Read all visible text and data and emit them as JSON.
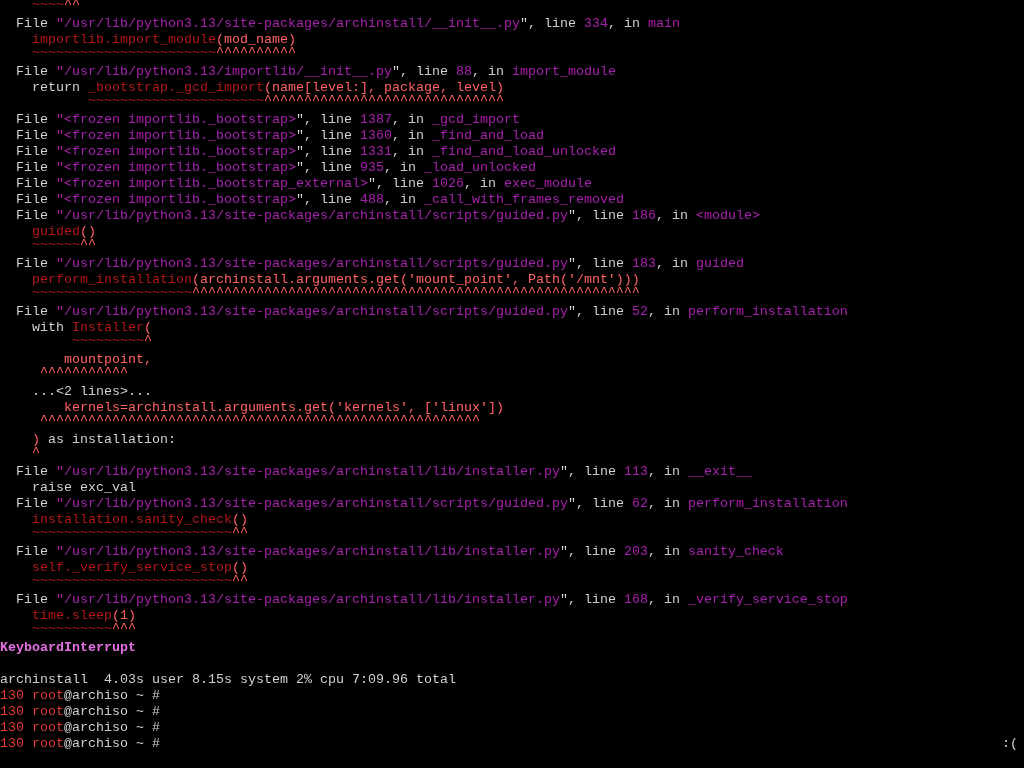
{
  "terminal": {
    "lines": [
      {
        "kind": "marks",
        "segments": [
          {
            "kind": "code",
            "text": "    ~~~~"
          },
          {
            "kind": "mark",
            "text": "^^"
          }
        ]
      },
      {
        "kind": "text",
        "segments": [
          {
            "kind": "plain",
            "text": "  File "
          },
          {
            "kind": "path",
            "text": "\"/usr/lib/python3.13/site-packages/archinstall/__init__.py"
          },
          {
            "kind": "plain",
            "text": "\", line "
          },
          {
            "kind": "path",
            "text": "334"
          },
          {
            "kind": "plain",
            "text": ", in "
          },
          {
            "kind": "path",
            "text": "main"
          }
        ]
      },
      {
        "kind": "text",
        "segments": [
          {
            "kind": "code",
            "text": "    importlib.import_module"
          },
          {
            "kind": "mark",
            "text": "(mod_name)"
          }
        ]
      },
      {
        "kind": "marks",
        "segments": [
          {
            "kind": "code",
            "text": "    ~~~~~~~~~~~~~~~~~~~~~~~"
          },
          {
            "kind": "mark",
            "text": "^^^^^^^^^^"
          }
        ]
      },
      {
        "kind": "text",
        "segments": [
          {
            "kind": "plain",
            "text": "  File "
          },
          {
            "kind": "path",
            "text": "\"/usr/lib/python3.13/importlib/__init__.py"
          },
          {
            "kind": "plain",
            "text": "\", line "
          },
          {
            "kind": "path",
            "text": "88"
          },
          {
            "kind": "plain",
            "text": ", in "
          },
          {
            "kind": "path",
            "text": "import_module"
          }
        ]
      },
      {
        "kind": "text",
        "segments": [
          {
            "kind": "plain",
            "text": "    return "
          },
          {
            "kind": "code",
            "text": "_bootstrap._gcd_import"
          },
          {
            "kind": "mark",
            "text": "(name[level:], package, level)"
          }
        ]
      },
      {
        "kind": "marks",
        "segments": [
          {
            "kind": "code",
            "text": "           ~~~~~~~~~~~~~~~~~~~~~~"
          },
          {
            "kind": "mark",
            "text": "^^^^^^^^^^^^^^^^^^^^^^^^^^^^^^"
          }
        ]
      },
      {
        "kind": "text",
        "segments": [
          {
            "kind": "plain",
            "text": "  File "
          },
          {
            "kind": "path",
            "text": "\"<frozen importlib._bootstrap>"
          },
          {
            "kind": "plain",
            "text": "\", line "
          },
          {
            "kind": "path",
            "text": "1387"
          },
          {
            "kind": "plain",
            "text": ", in "
          },
          {
            "kind": "path",
            "text": "_gcd_import"
          }
        ]
      },
      {
        "kind": "text",
        "segments": [
          {
            "kind": "plain",
            "text": "  File "
          },
          {
            "kind": "path",
            "text": "\"<frozen importlib._bootstrap>"
          },
          {
            "kind": "plain",
            "text": "\", line "
          },
          {
            "kind": "path",
            "text": "1360"
          },
          {
            "kind": "plain",
            "text": ", in "
          },
          {
            "kind": "path",
            "text": "_find_and_load"
          }
        ]
      },
      {
        "kind": "text",
        "segments": [
          {
            "kind": "plain",
            "text": "  File "
          },
          {
            "kind": "path",
            "text": "\"<frozen importlib._bootstrap>"
          },
          {
            "kind": "plain",
            "text": "\", line "
          },
          {
            "kind": "path",
            "text": "1331"
          },
          {
            "kind": "plain",
            "text": ", in "
          },
          {
            "kind": "path",
            "text": "_find_and_load_unlocked"
          }
        ]
      },
      {
        "kind": "text",
        "segments": [
          {
            "kind": "plain",
            "text": "  File "
          },
          {
            "kind": "path",
            "text": "\"<frozen importlib._bootstrap>"
          },
          {
            "kind": "plain",
            "text": "\", line "
          },
          {
            "kind": "path",
            "text": "935"
          },
          {
            "kind": "plain",
            "text": ", in "
          },
          {
            "kind": "path",
            "text": "_load_unlocked"
          }
        ]
      },
      {
        "kind": "text",
        "segments": [
          {
            "kind": "plain",
            "text": "  File "
          },
          {
            "kind": "path",
            "text": "\"<frozen importlib._bootstrap_external>"
          },
          {
            "kind": "plain",
            "text": "\", line "
          },
          {
            "kind": "path",
            "text": "1026"
          },
          {
            "kind": "plain",
            "text": ", in "
          },
          {
            "kind": "path",
            "text": "exec_module"
          }
        ]
      },
      {
        "kind": "text",
        "segments": [
          {
            "kind": "plain",
            "text": "  File "
          },
          {
            "kind": "path",
            "text": "\"<frozen importlib._bootstrap>"
          },
          {
            "kind": "plain",
            "text": "\", line "
          },
          {
            "kind": "path",
            "text": "488"
          },
          {
            "kind": "plain",
            "text": ", in "
          },
          {
            "kind": "path",
            "text": "_call_with_frames_removed"
          }
        ]
      },
      {
        "kind": "text",
        "segments": [
          {
            "kind": "plain",
            "text": "  File "
          },
          {
            "kind": "path",
            "text": "\"/usr/lib/python3.13/site-packages/archinstall/scripts/guided.py"
          },
          {
            "kind": "plain",
            "text": "\", line "
          },
          {
            "kind": "path",
            "text": "186"
          },
          {
            "kind": "plain",
            "text": ", in "
          },
          {
            "kind": "path",
            "text": "<module>"
          }
        ]
      },
      {
        "kind": "text",
        "segments": [
          {
            "kind": "code",
            "text": "    guided"
          },
          {
            "kind": "mark",
            "text": "()"
          }
        ]
      },
      {
        "kind": "marks",
        "segments": [
          {
            "kind": "code",
            "text": "    ~~~~~~"
          },
          {
            "kind": "mark",
            "text": "^^"
          }
        ]
      },
      {
        "kind": "text",
        "segments": [
          {
            "kind": "plain",
            "text": "  File "
          },
          {
            "kind": "path",
            "text": "\"/usr/lib/python3.13/site-packages/archinstall/scripts/guided.py"
          },
          {
            "kind": "plain",
            "text": "\", line "
          },
          {
            "kind": "path",
            "text": "183"
          },
          {
            "kind": "plain",
            "text": ", in "
          },
          {
            "kind": "path",
            "text": "guided"
          }
        ]
      },
      {
        "kind": "text",
        "segments": [
          {
            "kind": "code",
            "text": "    perform_installation"
          },
          {
            "kind": "mark",
            "text": "(archinstall.arguments.get('mount_point', Path('/mnt')))"
          }
        ]
      },
      {
        "kind": "marks",
        "segments": [
          {
            "kind": "code",
            "text": "    ~~~~~~~~~~~~~~~~~~~~"
          },
          {
            "kind": "mark",
            "text": "^^^^^^^^^^^^^^^^^^^^^^^^^^^^^^^^^^^^^^^^^^^^^^^^^^^^^^^^"
          }
        ]
      },
      {
        "kind": "text",
        "segments": [
          {
            "kind": "plain",
            "text": "  File "
          },
          {
            "kind": "path",
            "text": "\"/usr/lib/python3.13/site-packages/archinstall/scripts/guided.py"
          },
          {
            "kind": "plain",
            "text": "\", line "
          },
          {
            "kind": "path",
            "text": "52"
          },
          {
            "kind": "plain",
            "text": ", in "
          },
          {
            "kind": "path",
            "text": "perform_installation"
          }
        ]
      },
      {
        "kind": "text",
        "segments": [
          {
            "kind": "plain",
            "text": "    with "
          },
          {
            "kind": "code",
            "text": "Installer"
          },
          {
            "kind": "mark",
            "text": "("
          }
        ]
      },
      {
        "kind": "marks",
        "segments": [
          {
            "kind": "code",
            "text": "         ~~~~~~~~~"
          },
          {
            "kind": "mark",
            "text": "^"
          }
        ]
      },
      {
        "kind": "text",
        "segments": [
          {
            "kind": "mark",
            "text": "        mountpoint,"
          }
        ]
      },
      {
        "kind": "marks",
        "segments": [
          {
            "kind": "mark",
            "text": "     ^^^^^^^^^^^"
          }
        ]
      },
      {
        "kind": "text",
        "segments": [
          {
            "kind": "plain",
            "text": "    ...<2 lines>..."
          }
        ]
      },
      {
        "kind": "text",
        "segments": [
          {
            "kind": "mark",
            "text": "        kernels=archinstall.arguments.get('kernels', ['linux'])"
          }
        ]
      },
      {
        "kind": "marks",
        "segments": [
          {
            "kind": "mark",
            "text": "     ^^^^^^^^^^^^^^^^^^^^^^^^^^^^^^^^^^^^^^^^^^^^^^^^^^^^^^^"
          }
        ]
      },
      {
        "kind": "text",
        "segments": [
          {
            "kind": "mark",
            "text": "    )"
          },
          {
            "kind": "plain",
            "text": " as installation:"
          }
        ]
      },
      {
        "kind": "marks",
        "segments": [
          {
            "kind": "mark",
            "text": "    ^"
          }
        ]
      },
      {
        "kind": "text",
        "segments": [
          {
            "kind": "plain",
            "text": "  File "
          },
          {
            "kind": "path",
            "text": "\"/usr/lib/python3.13/site-packages/archinstall/lib/installer.py"
          },
          {
            "kind": "plain",
            "text": "\", line "
          },
          {
            "kind": "path",
            "text": "113"
          },
          {
            "kind": "plain",
            "text": ", in "
          },
          {
            "kind": "path",
            "text": "__exit__"
          }
        ]
      },
      {
        "kind": "text",
        "segments": [
          {
            "kind": "plain",
            "text": "    raise exc_val"
          }
        ]
      },
      {
        "kind": "text",
        "segments": [
          {
            "kind": "plain",
            "text": "  File "
          },
          {
            "kind": "path",
            "text": "\"/usr/lib/python3.13/site-packages/archinstall/scripts/guided.py"
          },
          {
            "kind": "plain",
            "text": "\", line "
          },
          {
            "kind": "path",
            "text": "62"
          },
          {
            "kind": "plain",
            "text": ", in "
          },
          {
            "kind": "path",
            "text": "perform_installation"
          }
        ]
      },
      {
        "kind": "text",
        "segments": [
          {
            "kind": "code",
            "text": "    installation.sanity_check"
          },
          {
            "kind": "mark",
            "text": "()"
          }
        ]
      },
      {
        "kind": "marks",
        "segments": [
          {
            "kind": "code",
            "text": "    ~~~~~~~~~~~~~~~~~~~~~~~~~"
          },
          {
            "kind": "mark",
            "text": "^^"
          }
        ]
      },
      {
        "kind": "text",
        "segments": [
          {
            "kind": "plain",
            "text": "  File "
          },
          {
            "kind": "path",
            "text": "\"/usr/lib/python3.13/site-packages/archinstall/lib/installer.py"
          },
          {
            "kind": "plain",
            "text": "\", line "
          },
          {
            "kind": "path",
            "text": "203"
          },
          {
            "kind": "plain",
            "text": ", in "
          },
          {
            "kind": "path",
            "text": "sanity_check"
          }
        ]
      },
      {
        "kind": "text",
        "segments": [
          {
            "kind": "code",
            "text": "    self._verify_service_stop"
          },
          {
            "kind": "mark",
            "text": "()"
          }
        ]
      },
      {
        "kind": "marks",
        "segments": [
          {
            "kind": "code",
            "text": "    ~~~~~~~~~~~~~~~~~~~~~~~~~"
          },
          {
            "kind": "mark",
            "text": "^^"
          }
        ]
      },
      {
        "kind": "text",
        "segments": [
          {
            "kind": "plain",
            "text": "  File "
          },
          {
            "kind": "path",
            "text": "\"/usr/lib/python3.13/site-packages/archinstall/lib/installer.py"
          },
          {
            "kind": "plain",
            "text": "\", line "
          },
          {
            "kind": "path",
            "text": "168"
          },
          {
            "kind": "plain",
            "text": ", in "
          },
          {
            "kind": "path",
            "text": "_verify_service_stop"
          }
        ]
      },
      {
        "kind": "text",
        "segments": [
          {
            "kind": "code",
            "text": "    time.sleep"
          },
          {
            "kind": "mark",
            "text": "(1)"
          }
        ]
      },
      {
        "kind": "marks",
        "segments": [
          {
            "kind": "code",
            "text": "    ~~~~~~~~~~"
          },
          {
            "kind": "mark",
            "text": "^^^"
          }
        ]
      },
      {
        "kind": "error",
        "segments": [
          {
            "kind": "error",
            "text": "KeyboardInterrupt"
          }
        ]
      },
      {
        "kind": "blank"
      },
      {
        "kind": "text",
        "segments": [
          {
            "kind": "plain",
            "text": "archinstall  4.03s user 8.15s system 2% cpu 7:09.96 total"
          }
        ]
      },
      {
        "kind": "text",
        "segments": [
          {
            "kind": "status",
            "text": "130 root"
          },
          {
            "kind": "plain",
            "text": "@archiso ~ #"
          }
        ]
      },
      {
        "kind": "text",
        "segments": [
          {
            "kind": "status",
            "text": "130 root"
          },
          {
            "kind": "plain",
            "text": "@archiso ~ #"
          }
        ]
      },
      {
        "kind": "text",
        "segments": [
          {
            "kind": "status",
            "text": "130 root"
          },
          {
            "kind": "plain",
            "text": "@archiso ~ #"
          }
        ]
      },
      {
        "kind": "text",
        "segments": [
          {
            "kind": "status",
            "text": "130 root"
          },
          {
            "kind": "plain",
            "text": "@archiso ~ #"
          }
        ],
        "right_prompt": ":("
      }
    ]
  }
}
